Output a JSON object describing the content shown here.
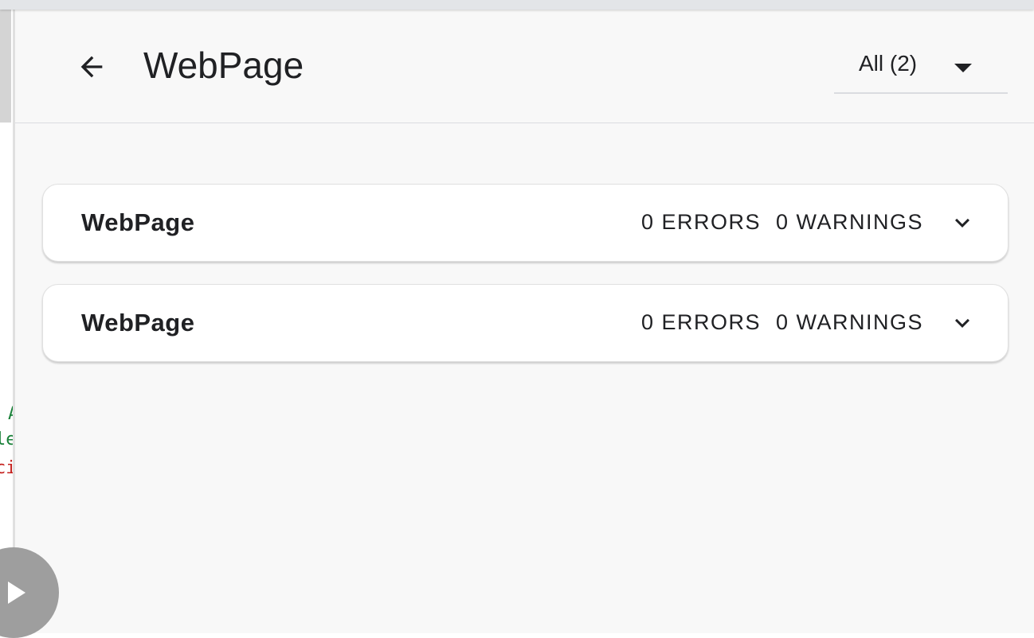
{
  "left_pane": {
    "code_fragments": [
      "A",
      "le",
      "ci"
    ],
    "run_icon": "play-icon"
  },
  "header": {
    "back_icon": "arrow-left-icon",
    "title": "WebPage",
    "filter": {
      "selected": "All (2)",
      "icon": "caret-down-icon"
    }
  },
  "results": [
    {
      "title": "WebPage",
      "errors": "0 ERRORS",
      "warnings": "0 WARNINGS",
      "icon": "chevron-down-icon"
    },
    {
      "title": "WebPage",
      "errors": "0 ERRORS",
      "warnings": "0 WARNINGS",
      "icon": "chevron-down-icon"
    }
  ],
  "colors": {
    "panel_bg": "#f8f8f8",
    "text": "#202124",
    "card_bg": "#ffffff",
    "code_green": "#188038",
    "code_red": "#c5221f",
    "run_button": "#9e9e9e"
  }
}
